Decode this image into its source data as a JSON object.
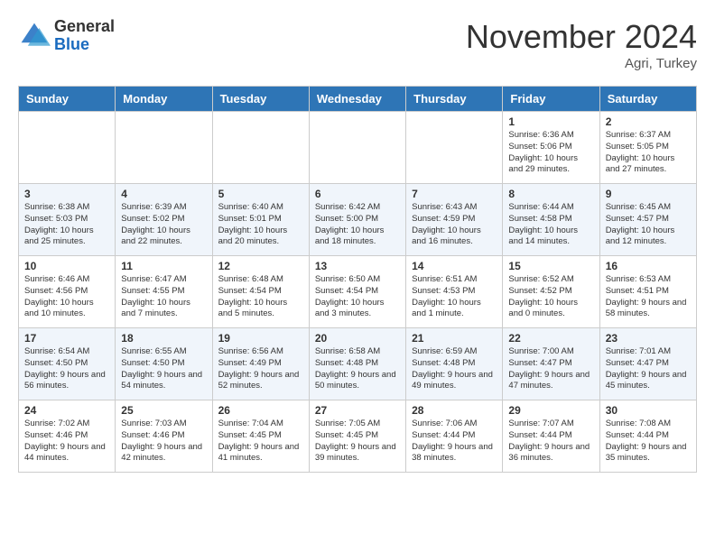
{
  "logo": {
    "general": "General",
    "blue": "Blue"
  },
  "header": {
    "month": "November 2024",
    "location": "Agri, Turkey"
  },
  "weekdays": [
    "Sunday",
    "Monday",
    "Tuesday",
    "Wednesday",
    "Thursday",
    "Friday",
    "Saturday"
  ],
  "weeks": [
    [
      {
        "day": "",
        "info": ""
      },
      {
        "day": "",
        "info": ""
      },
      {
        "day": "",
        "info": ""
      },
      {
        "day": "",
        "info": ""
      },
      {
        "day": "",
        "info": ""
      },
      {
        "day": "1",
        "info": "Sunrise: 6:36 AM\nSunset: 5:06 PM\nDaylight: 10 hours and 29 minutes."
      },
      {
        "day": "2",
        "info": "Sunrise: 6:37 AM\nSunset: 5:05 PM\nDaylight: 10 hours and 27 minutes."
      }
    ],
    [
      {
        "day": "3",
        "info": "Sunrise: 6:38 AM\nSunset: 5:03 PM\nDaylight: 10 hours and 25 minutes."
      },
      {
        "day": "4",
        "info": "Sunrise: 6:39 AM\nSunset: 5:02 PM\nDaylight: 10 hours and 22 minutes."
      },
      {
        "day": "5",
        "info": "Sunrise: 6:40 AM\nSunset: 5:01 PM\nDaylight: 10 hours and 20 minutes."
      },
      {
        "day": "6",
        "info": "Sunrise: 6:42 AM\nSunset: 5:00 PM\nDaylight: 10 hours and 18 minutes."
      },
      {
        "day": "7",
        "info": "Sunrise: 6:43 AM\nSunset: 4:59 PM\nDaylight: 10 hours and 16 minutes."
      },
      {
        "day": "8",
        "info": "Sunrise: 6:44 AM\nSunset: 4:58 PM\nDaylight: 10 hours and 14 minutes."
      },
      {
        "day": "9",
        "info": "Sunrise: 6:45 AM\nSunset: 4:57 PM\nDaylight: 10 hours and 12 minutes."
      }
    ],
    [
      {
        "day": "10",
        "info": "Sunrise: 6:46 AM\nSunset: 4:56 PM\nDaylight: 10 hours and 10 minutes."
      },
      {
        "day": "11",
        "info": "Sunrise: 6:47 AM\nSunset: 4:55 PM\nDaylight: 10 hours and 7 minutes."
      },
      {
        "day": "12",
        "info": "Sunrise: 6:48 AM\nSunset: 4:54 PM\nDaylight: 10 hours and 5 minutes."
      },
      {
        "day": "13",
        "info": "Sunrise: 6:50 AM\nSunset: 4:54 PM\nDaylight: 10 hours and 3 minutes."
      },
      {
        "day": "14",
        "info": "Sunrise: 6:51 AM\nSunset: 4:53 PM\nDaylight: 10 hours and 1 minute."
      },
      {
        "day": "15",
        "info": "Sunrise: 6:52 AM\nSunset: 4:52 PM\nDaylight: 10 hours and 0 minutes."
      },
      {
        "day": "16",
        "info": "Sunrise: 6:53 AM\nSunset: 4:51 PM\nDaylight: 9 hours and 58 minutes."
      }
    ],
    [
      {
        "day": "17",
        "info": "Sunrise: 6:54 AM\nSunset: 4:50 PM\nDaylight: 9 hours and 56 minutes."
      },
      {
        "day": "18",
        "info": "Sunrise: 6:55 AM\nSunset: 4:50 PM\nDaylight: 9 hours and 54 minutes."
      },
      {
        "day": "19",
        "info": "Sunrise: 6:56 AM\nSunset: 4:49 PM\nDaylight: 9 hours and 52 minutes."
      },
      {
        "day": "20",
        "info": "Sunrise: 6:58 AM\nSunset: 4:48 PM\nDaylight: 9 hours and 50 minutes."
      },
      {
        "day": "21",
        "info": "Sunrise: 6:59 AM\nSunset: 4:48 PM\nDaylight: 9 hours and 49 minutes."
      },
      {
        "day": "22",
        "info": "Sunrise: 7:00 AM\nSunset: 4:47 PM\nDaylight: 9 hours and 47 minutes."
      },
      {
        "day": "23",
        "info": "Sunrise: 7:01 AM\nSunset: 4:47 PM\nDaylight: 9 hours and 45 minutes."
      }
    ],
    [
      {
        "day": "24",
        "info": "Sunrise: 7:02 AM\nSunset: 4:46 PM\nDaylight: 9 hours and 44 minutes."
      },
      {
        "day": "25",
        "info": "Sunrise: 7:03 AM\nSunset: 4:46 PM\nDaylight: 9 hours and 42 minutes."
      },
      {
        "day": "26",
        "info": "Sunrise: 7:04 AM\nSunset: 4:45 PM\nDaylight: 9 hours and 41 minutes."
      },
      {
        "day": "27",
        "info": "Sunrise: 7:05 AM\nSunset: 4:45 PM\nDaylight: 9 hours and 39 minutes."
      },
      {
        "day": "28",
        "info": "Sunrise: 7:06 AM\nSunset: 4:44 PM\nDaylight: 9 hours and 38 minutes."
      },
      {
        "day": "29",
        "info": "Sunrise: 7:07 AM\nSunset: 4:44 PM\nDaylight: 9 hours and 36 minutes."
      },
      {
        "day": "30",
        "info": "Sunrise: 7:08 AM\nSunset: 4:44 PM\nDaylight: 9 hours and 35 minutes."
      }
    ]
  ]
}
